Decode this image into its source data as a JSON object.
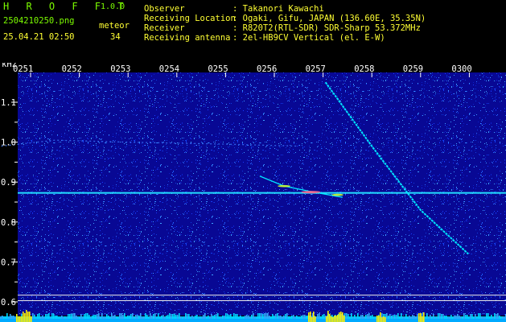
{
  "header": {
    "app_title": "H R O F F T",
    "version": "1.0.0",
    "filename": "2504210250.png",
    "meteor_label": "meteor",
    "meteor_count": "34",
    "datetime": "25.04.21 02:50",
    "info_labels": [
      "Observer",
      "Receiving Location",
      "Receiver",
      "Receiving antenna"
    ],
    "info_values": [
      ": Takanori Kawachi",
      ": Ogaki, Gifu, JAPAN (136.60E, 35.35N)",
      ": R820T2(RTL-SDR) SDR-Sharp 53.372MHz",
      ": 2el-HB9CV Vertical (el. E-W)"
    ]
  },
  "colors": {
    "background": "#000000",
    "noise_base": "#080894",
    "header_green": "#7CFC00",
    "header_yellow": "#ffff33",
    "trace_cyan": "#00e5ff",
    "carrier_line": "#22ddff",
    "grid_line": "#e8e8e8"
  },
  "chart_data": {
    "type": "heatmap",
    "title": "",
    "xlabel": "",
    "ylabel": "kHz",
    "x_tick_labels": [
      "0251",
      "0252",
      "0253",
      "0254",
      "0255",
      "0256",
      "0257",
      "0258",
      "0259",
      "0300"
    ],
    "y_tick_labels": [
      "1.1",
      "1.0",
      "0.9",
      "0.8",
      "0.7",
      "0.6"
    ],
    "y_ticks": [
      1.1,
      1.0,
      0.9,
      0.8,
      0.7,
      0.6
    ],
    "ylim": [
      0.58,
      1.18
    ],
    "xlim": [
      0.5,
      10.0
    ],
    "x_unit_note": "minutes 02:50-03:00",
    "reference_lines_khz": [
      0.873,
      0.617,
      0.603
    ],
    "features": [
      {
        "name": "carrier",
        "x": [
          0.0,
          10.0
        ],
        "y": [
          0.873,
          0.873
        ]
      },
      {
        "name": "meteor_head_echo_1",
        "x": [
          7.05,
          8.0,
          9.0,
          9.98
        ],
        "y": [
          1.15,
          0.99,
          0.83,
          0.72
        ]
      },
      {
        "name": "meteor_trail_2",
        "x": [
          5.7,
          6.2,
          6.8,
          7.4
        ],
        "y": [
          0.915,
          0.89,
          0.875,
          0.862
        ]
      },
      {
        "name": "meteor_faint_3",
        "x": [
          0.4,
          1.5,
          3.0,
          5.0,
          6.5
        ],
        "y": [
          0.99,
          1.005,
          1.0,
          0.995,
          0.99
        ]
      }
    ]
  }
}
